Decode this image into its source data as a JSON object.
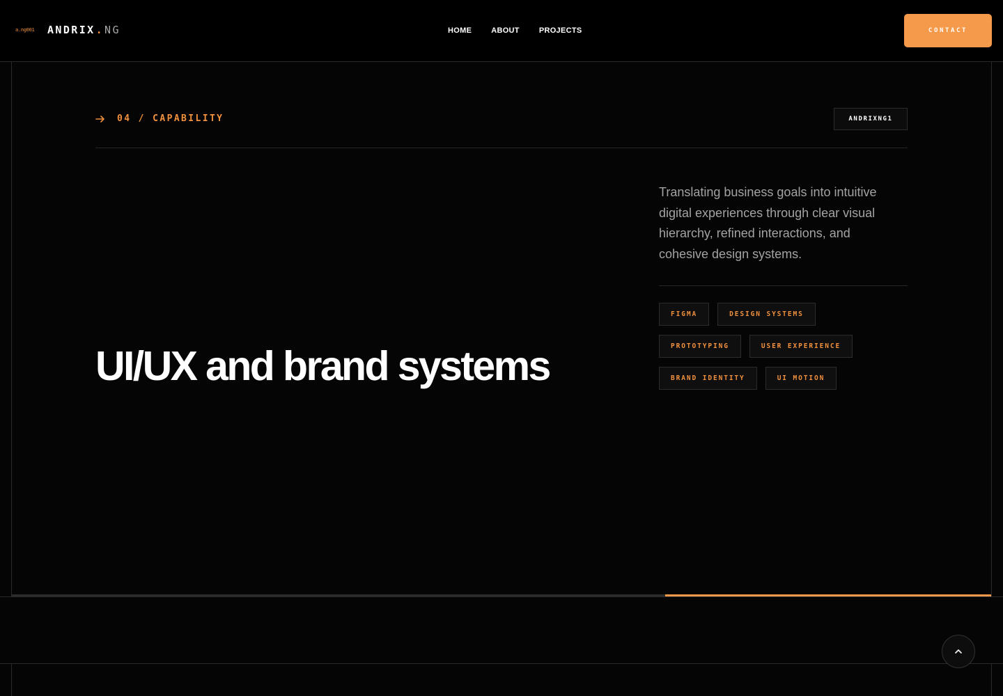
{
  "header": {
    "logo_mark": "a.ng001",
    "logo_name": "ANDRIX",
    "logo_dot": ".",
    "logo_suffix": "NG",
    "nav": [
      {
        "label": "HOME"
      },
      {
        "label": "ABOUT"
      },
      {
        "label": "PROJECTS"
      }
    ],
    "contact_label": "CONTACT"
  },
  "section": {
    "index_label": "04 / CAPABILITY",
    "badge": "ANDRIXNG1",
    "headline": "UI/UX and brand systems",
    "description": "Translating business goals into intuitive digital experiences through clear visual hierarchy, refined interactions, and cohesive design systems.",
    "chips": [
      [
        "FIGMA",
        "DESIGN SYSTEMS"
      ],
      [
        "PROTOTYPING",
        "USER EXPERIENCE"
      ],
      [
        "BRAND IDENTITY",
        "UI MOTION"
      ]
    ],
    "progress_fraction": 0.333
  },
  "colors": {
    "accent": "#f5994a",
    "background": "#050505",
    "text_muted": "#a3a3a3"
  },
  "icons": {
    "section_arrow": "arrow-right-icon",
    "scroll_top": "chevron-up-icon"
  }
}
